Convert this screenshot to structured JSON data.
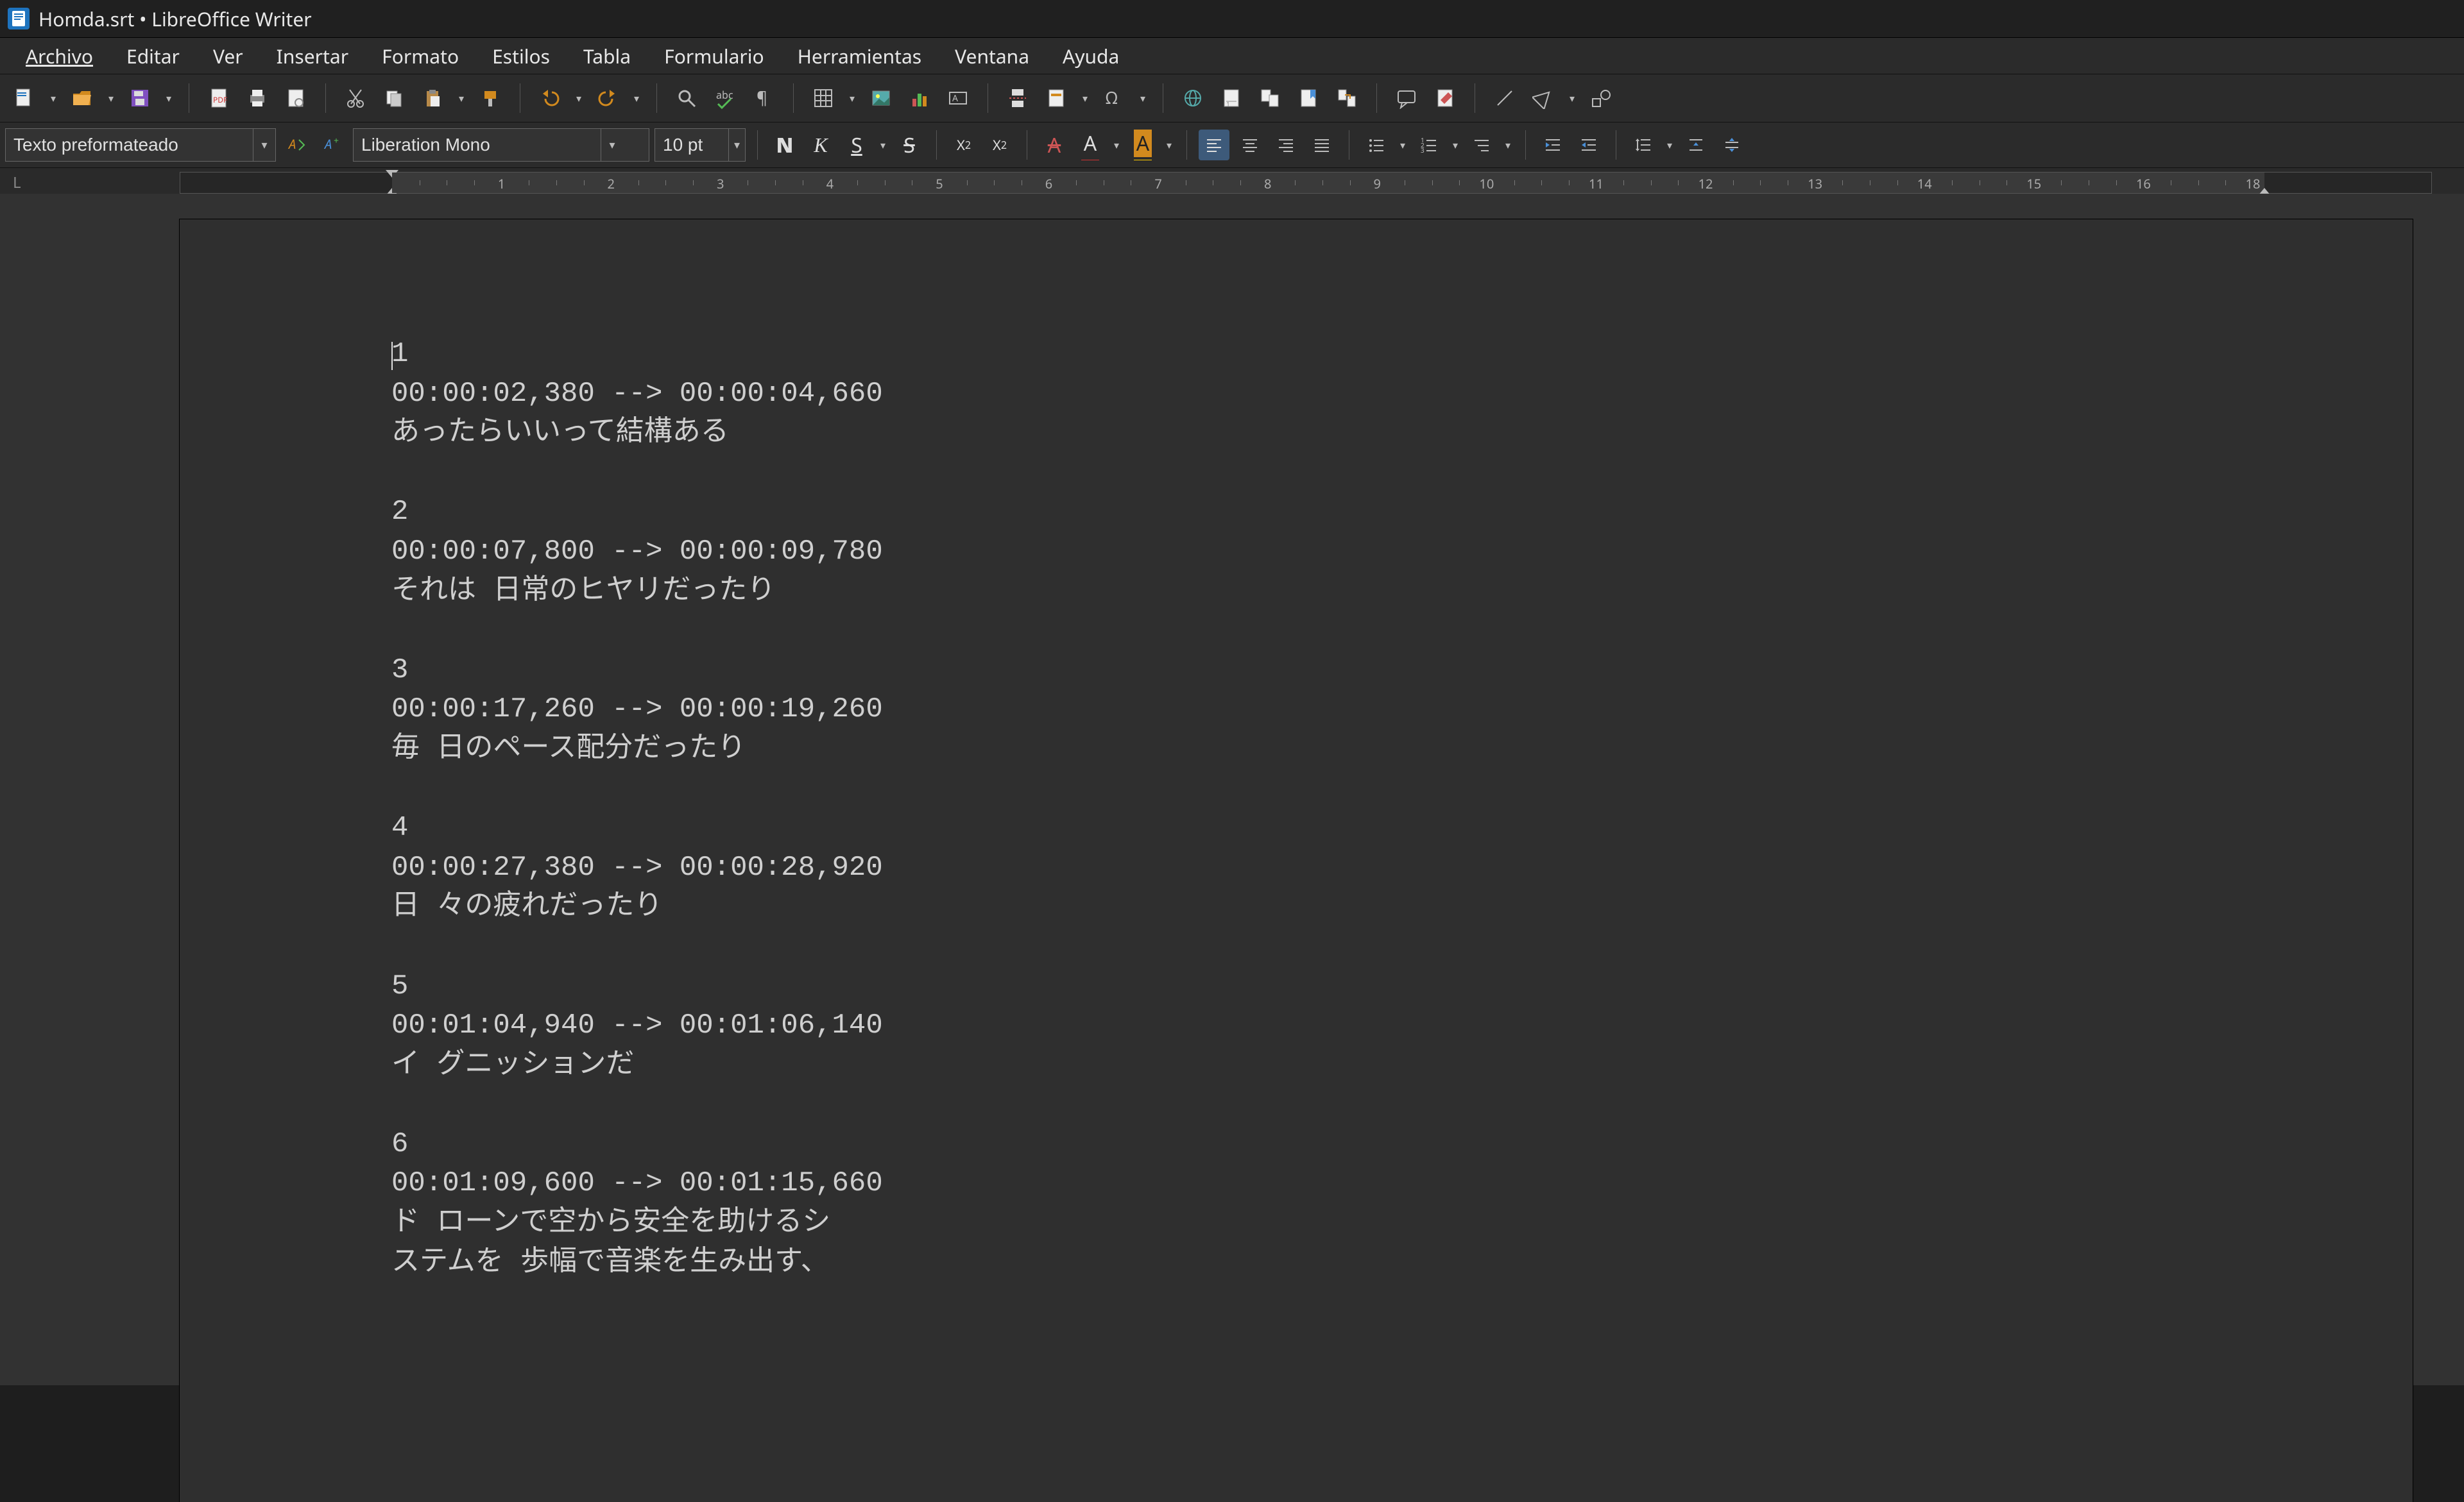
{
  "title": "Homda.srt • LibreOffice Writer",
  "menus": [
    "Archivo",
    "Editar",
    "Ver",
    "Insertar",
    "Formato",
    "Estilos",
    "Tabla",
    "Formulario",
    "Herramientas",
    "Ventana",
    "Ayuda"
  ],
  "para_style": "Texto preformateado",
  "font_name": "Liberation Mono",
  "font_size": "10 pt",
  "ruler_numbers": [
    "1",
    "2",
    "3",
    "4",
    "5",
    "6",
    "7",
    "8",
    "9",
    "10",
    "11",
    "12",
    "13",
    "14",
    "15",
    "16",
    "18"
  ],
  "accent": "#d28a1e",
  "brand_blue": "#1e73be",
  "fontcolor_bar": "#cc3333",
  "highlight_bar": "#ffcc00",
  "subtitles": [
    {
      "idx": "1",
      "time": "00:00:02,380 --> 00:00:04,660",
      "lines": [
        "あったらいいって結構ある"
      ]
    },
    {
      "idx": "2",
      "time": "00:00:07,800 --> 00:00:09,780",
      "lines": [
        "それは 日常のヒヤリだったり"
      ]
    },
    {
      "idx": "3",
      "time": "00:00:17,260 --> 00:00:19,260",
      "lines": [
        "毎 日のペース配分だったり"
      ]
    },
    {
      "idx": "4",
      "time": "00:00:27,380 --> 00:00:28,920",
      "lines": [
        "日 々の疲れだったり"
      ]
    },
    {
      "idx": "5",
      "time": "00:01:04,940 --> 00:01:06,140",
      "lines": [
        "イ グニッションだ"
      ]
    },
    {
      "idx": "6",
      "time": "00:01:09,600 --> 00:01:15,660",
      "lines": [
        "ド ローンで空から安全を助けるシ",
        "ステムを 歩幅で音楽を生み出す、"
      ]
    }
  ]
}
